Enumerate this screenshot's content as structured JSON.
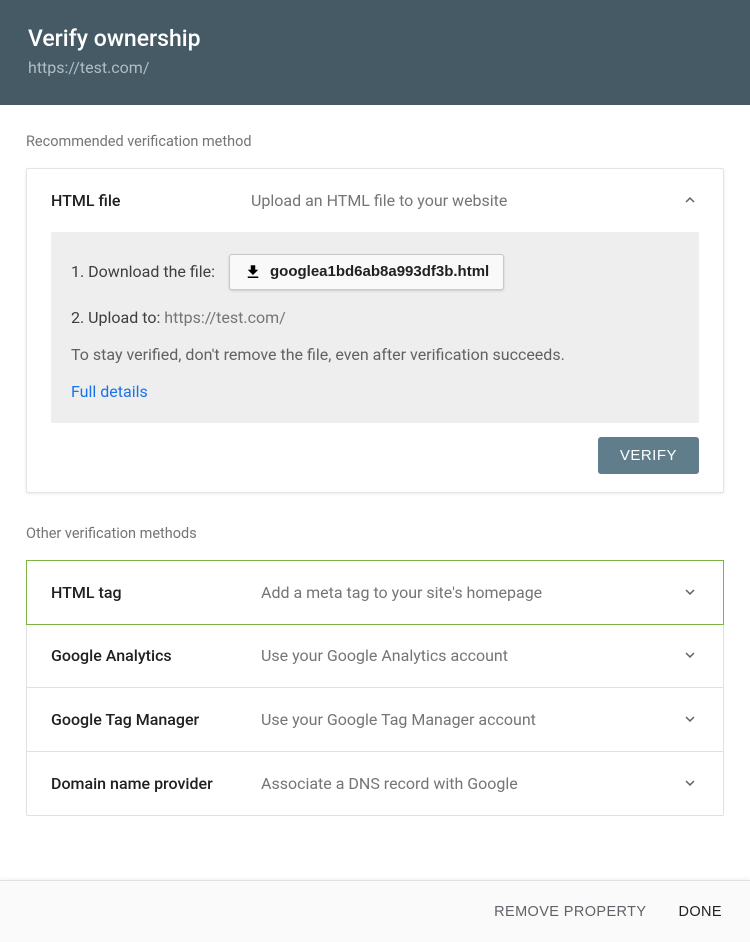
{
  "header": {
    "title": "Verify ownership",
    "url": "https://test.com/"
  },
  "recommended": {
    "section_label": "Recommended verification method",
    "method_name": "HTML file",
    "method_desc": "Upload an HTML file to your website",
    "step1_label": "1. Download the file:",
    "download_filename": "googlea1bd6ab8a993df3b.html",
    "step2_prefix": "2. Upload to: ",
    "step2_url": "https://test.com/",
    "note": "To stay verified, don't remove the file, even after verification succeeds.",
    "details_link": "Full details",
    "verify_label": "VERIFY"
  },
  "other": {
    "section_label": "Other verification methods",
    "methods": [
      {
        "name": "HTML tag",
        "desc": "Add a meta tag to your site's homepage"
      },
      {
        "name": "Google Analytics",
        "desc": "Use your Google Analytics account"
      },
      {
        "name": "Google Tag Manager",
        "desc": "Use your Google Tag Manager account"
      },
      {
        "name": "Domain name provider",
        "desc": "Associate a DNS record with Google"
      }
    ]
  },
  "footer": {
    "remove_label": "REMOVE PROPERTY",
    "done_label": "DONE"
  }
}
